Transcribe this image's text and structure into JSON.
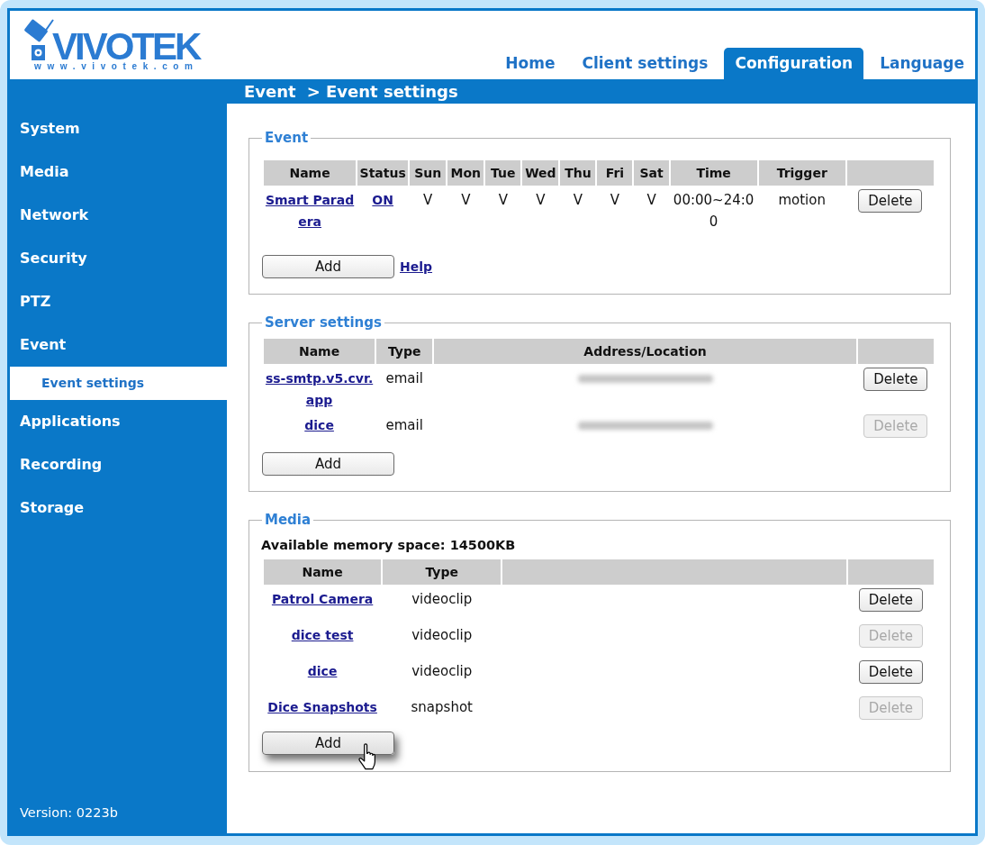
{
  "logo": {
    "wordmark": "VIVOTEK",
    "url": "www.vivotek.com"
  },
  "tabs": [
    {
      "label": "Home",
      "selected": false
    },
    {
      "label": "Client settings",
      "selected": false
    },
    {
      "label": "Configuration",
      "selected": true
    },
    {
      "label": "Language",
      "selected": false
    }
  ],
  "breadcrumb": [
    "Event",
    "> Event settings"
  ],
  "sidebar": {
    "items": [
      {
        "label": "System",
        "selected": false
      },
      {
        "label": "Media",
        "selected": false
      },
      {
        "label": "Network",
        "selected": false
      },
      {
        "label": "Security",
        "selected": false
      },
      {
        "label": "PTZ",
        "selected": false
      },
      {
        "label": "Event",
        "selected": false,
        "children": [
          {
            "label": "Event settings",
            "selected": true
          }
        ]
      },
      {
        "label": "Applications",
        "selected": false
      },
      {
        "label": "Recording",
        "selected": false
      },
      {
        "label": "Storage",
        "selected": false
      }
    ],
    "version": "Version: 0223b"
  },
  "event": {
    "legend": "Event",
    "columns": [
      "Name",
      "Status",
      "Sun",
      "Mon",
      "Tue",
      "Wed",
      "Thu",
      "Fri",
      "Sat",
      "Time",
      "Trigger"
    ],
    "rows": [
      {
        "name": "Smart Paradera",
        "status": "ON",
        "days": [
          "V",
          "V",
          "V",
          "V",
          "V",
          "V",
          "V"
        ],
        "time": "00:00~24:00",
        "trigger": "motion",
        "delete": {
          "label": "Delete",
          "disabled": false
        }
      }
    ],
    "add_button": {
      "label": "Add",
      "hovered": false
    },
    "help_link": "Help"
  },
  "server": {
    "legend": "Server settings",
    "columns": [
      "Name",
      "Type",
      "Address/Location"
    ],
    "rows": [
      {
        "name": "ss-smtp.v5.cvr.app",
        "type": "email",
        "address_blurred": true,
        "delete": {
          "label": "Delete",
          "disabled": false
        }
      },
      {
        "name": "dice",
        "type": "email",
        "address_blurred": true,
        "delete": {
          "label": "Delete",
          "disabled": true
        }
      }
    ],
    "add_button": {
      "label": "Add",
      "hovered": false
    }
  },
  "media": {
    "legend": "Media",
    "memory": "Available memory space: 14500KB",
    "columns": [
      "Name",
      "Type"
    ],
    "rows": [
      {
        "name": "Patrol Camera",
        "type": "videoclip",
        "delete": {
          "label": "Delete",
          "disabled": false
        }
      },
      {
        "name": "dice test",
        "type": "videoclip",
        "delete": {
          "label": "Delete",
          "disabled": true
        }
      },
      {
        "name": "dice",
        "type": "videoclip",
        "delete": {
          "label": "Delete",
          "disabled": false
        }
      },
      {
        "name": "Dice Snapshots",
        "type": "snapshot",
        "delete": {
          "label": "Delete",
          "disabled": true
        }
      }
    ],
    "add_button": {
      "label": "Add",
      "hovered": true
    }
  }
}
